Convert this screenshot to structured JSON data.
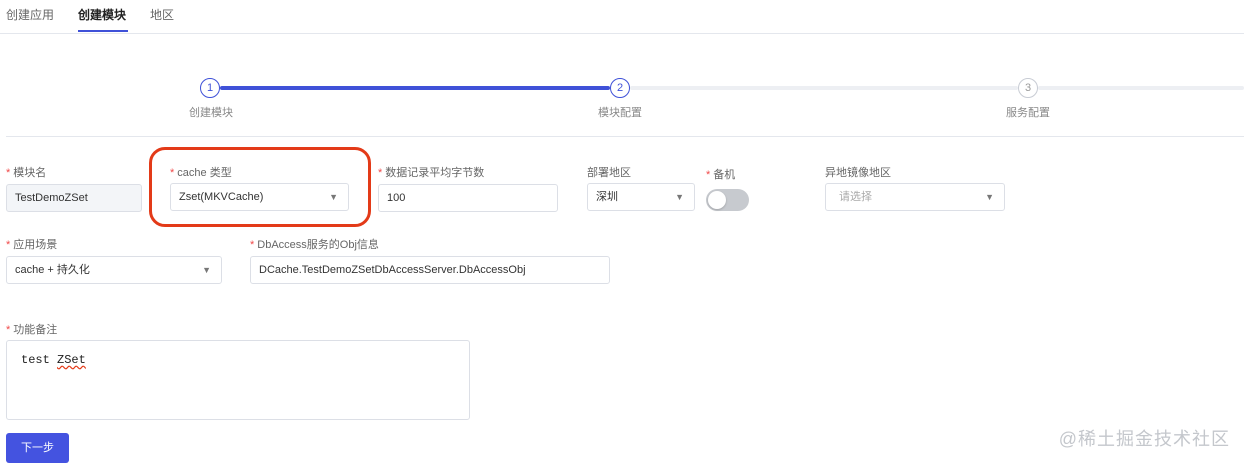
{
  "tabs": [
    {
      "label": "创建应用",
      "active": false
    },
    {
      "label": "创建模块",
      "active": true
    },
    {
      "label": "地区",
      "active": false
    }
  ],
  "steps": [
    {
      "number": "1",
      "label": "创建模块",
      "status": "done"
    },
    {
      "number": "2",
      "label": "模块配置",
      "status": "current"
    },
    {
      "number": "3",
      "label": "服务配置",
      "status": "todo"
    }
  ],
  "form": {
    "required_mark": "*",
    "module_name": {
      "label": "模块名",
      "value": "TestDemoZSet"
    },
    "cache_type": {
      "label": "cache 类型",
      "value": "Zset(MKVCache)"
    },
    "avg_record_bytes": {
      "label": "数据记录平均字节数",
      "value": "100"
    },
    "deploy_region": {
      "label": "部署地区",
      "value": "深圳"
    },
    "backup": {
      "label": "备机",
      "enabled": false
    },
    "mirror_region": {
      "label": "异地镜像地区",
      "placeholder": "请选择"
    },
    "scenario": {
      "label": "应用场景",
      "value": "cache + 持久化"
    },
    "dbaccess_obj": {
      "label": "DbAccess服务的Obj信息",
      "value": "DCache.TestDemoZSetDbAccessServer.DbAccessObj"
    },
    "remark": {
      "label": "功能备注",
      "value_prefix": "test ",
      "value_flagged": "ZSet"
    }
  },
  "next_button": {
    "label": "下一步"
  },
  "watermark": "@稀土掘金技术社区",
  "colors": {
    "accent": "#3f51d8",
    "button": "#4453e0",
    "highlight": "#e33a18",
    "required": "#f04848"
  }
}
